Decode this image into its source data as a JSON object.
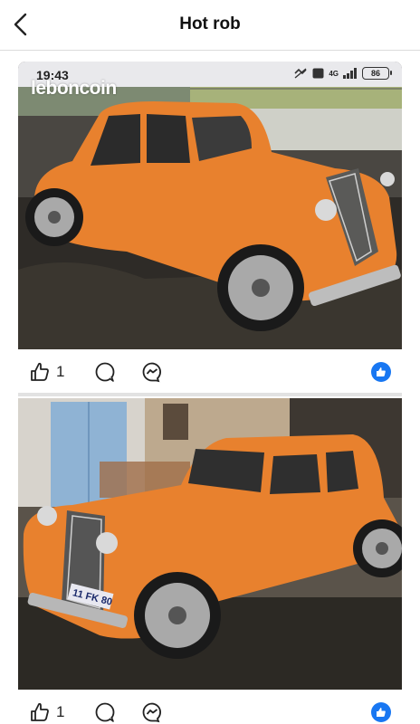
{
  "header": {
    "title": "Hot rob"
  },
  "posts": [
    {
      "status_bar": {
        "time": "19:43",
        "network": "4G",
        "battery": "86"
      },
      "watermark": "leboncoin",
      "likes": "1"
    },
    {
      "plate": "11 FK 80",
      "likes": "1"
    }
  ],
  "colors": {
    "car": "#e8812e",
    "reaction": "#1877f2"
  },
  "icons": [
    "back-chevron-icon",
    "like-thumb-icon",
    "comment-icon",
    "messenger-icon",
    "like-reaction-icon"
  ]
}
